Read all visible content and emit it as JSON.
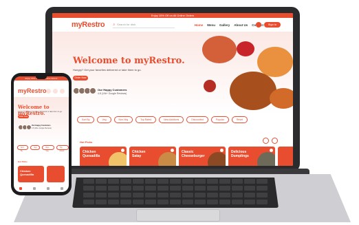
{
  "laptop": {
    "topbar": "Enjoy 15% Off on All Online Orders",
    "logo": "myRestro",
    "search_placeholder": "Search for dish",
    "nav": [
      "Home",
      "Menu",
      "Gallery",
      "About Us",
      "Contact Us"
    ],
    "signin": "Sign In",
    "hero_title": "Welcome to myRestro.",
    "hero_subtitle": "Hungry? Get your favorites delivered or take them to go.",
    "order_button": "Order Now",
    "happy_title": "Our Happy Customers",
    "rating": "4.8 (10k+ Google Reviews)",
    "filters": [
      "Sort By",
      "Veg",
      "Non-Veg",
      "Top Rated",
      "New Additions",
      "Discounted",
      "Popular",
      "Reset"
    ],
    "hot_picks": "Hot Picks",
    "cards": [
      "Chicken Quesadilla",
      "Chicken Satay",
      "Classic Cheeseburger",
      "Delicious Dumplings"
    ]
  },
  "phone": {
    "topbar": "Enjoy 15% Off on All Online Orders",
    "logo": "myRestro",
    "hero_title": "Welcome to myRestro.",
    "hero_subtitle": "Hungry? Get your favorites delivered or take them to go.",
    "order_button": "Order Now",
    "happy_title": "Our Happy Customers",
    "rating": "4.8 (10k+ Google Reviews)",
    "filters": [
      "Sort By",
      "Veg",
      "Non-Veg",
      "Top Rated"
    ],
    "hot_picks": "Hot Picks",
    "card": "Chicken Quesadilla"
  },
  "colors": {
    "accent": "#e84d2f",
    "dark": "#2b2b2e"
  }
}
